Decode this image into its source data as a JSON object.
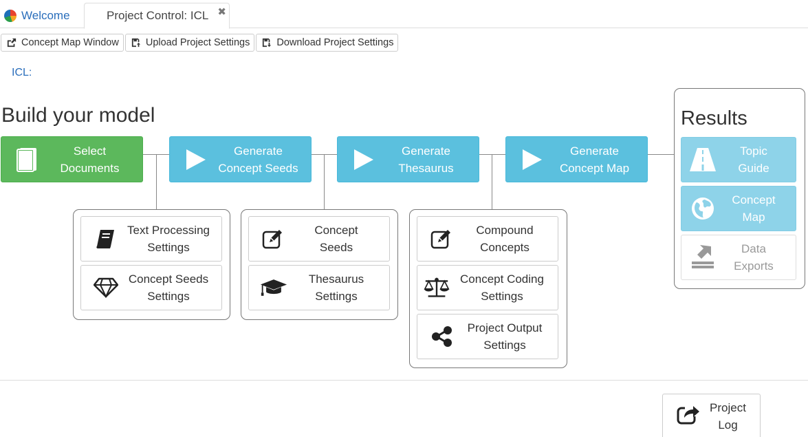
{
  "tabs": {
    "welcome": "Welcome",
    "project": "Project Control: ICL",
    "close_glyph": "✖"
  },
  "toolbar": {
    "concept_map_window": "Concept Map Window",
    "upload_settings": "Upload Project Settings",
    "download_settings": "Download Project Settings"
  },
  "project_label": "ICL:",
  "build_title": "Build your model",
  "stages": {
    "select": [
      "Select",
      "Documents"
    ],
    "seeds": [
      "Generate",
      "Concept Seeds"
    ],
    "thesaurus": [
      "Generate",
      "Thesaurus"
    ],
    "map": [
      "Generate",
      "Concept Map"
    ]
  },
  "settings": {
    "text_processing": [
      "Text Processing",
      "Settings"
    ],
    "concept_seeds_settings": [
      "Concept Seeds",
      "Settings"
    ],
    "concept_seeds": [
      "Concept",
      "Seeds"
    ],
    "thesaurus_settings": [
      "Thesaurus",
      "Settings"
    ],
    "compound_concepts": [
      "Compound",
      "Concepts"
    ],
    "concept_coding": [
      "Concept Coding",
      "Settings"
    ],
    "project_output": [
      "Project Output",
      "Settings"
    ]
  },
  "results": {
    "title": "Results",
    "topic_guide": [
      "Topic",
      "Guide"
    ],
    "concept_map": [
      "Concept",
      "Map"
    ],
    "data_exports": [
      "Data",
      "Exports"
    ]
  },
  "project_log": [
    "Project",
    "Log"
  ],
  "colors": {
    "green": "#5cb85c",
    "blue": "#5bc0de",
    "light_blue": "#8ed3e9",
    "link": "#2a6ebb"
  }
}
